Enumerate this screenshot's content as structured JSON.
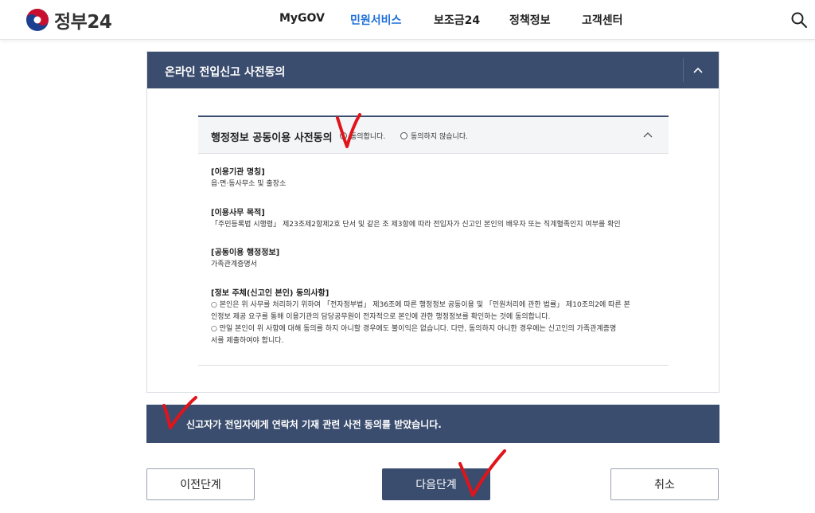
{
  "header": {
    "logo_text": "정부24",
    "nav": [
      {
        "label": "MyGOV"
      },
      {
        "label": "민원서비스"
      },
      {
        "label": "보조금24"
      },
      {
        "label": "정책정보"
      },
      {
        "label": "고객센터"
      }
    ],
    "search_icon": "search-icon",
    "active_color": "#1e6fd9"
  },
  "panel": {
    "title": "온라인 전입신고 사전동의",
    "toggle_icon": "chevron-up-icon",
    "header_color": "#3a4d6e",
    "sub": {
      "title": "행정정보 공동이용 사전동의",
      "agree_label": "동의합니다.",
      "disagree_label": "동의하지 않습니다.",
      "sections": [
        {
          "heading": "[이용기관 명칭]",
          "lines": [
            "읍·면·동사무소 및 출장소"
          ]
        },
        {
          "heading": "[이용사무 목적]",
          "lines": [
            "「주민등록법 시행령」 제23조제2항제2호 단서 및 같은 조 제3항에 따라 전입자가 신고인 본인의 배우자 또는 직계혈족인지 여부를 확인"
          ]
        },
        {
          "heading": "[공동이용 행정정보]",
          "lines": [
            "가족관계증명서"
          ]
        },
        {
          "heading": "[정보 주체(신고인 본인) 동의사항]",
          "lines": [
            "○ 본인은 위 사무를 처리하기 위하여 「전자정부법」 제36조에 따른 행정정보 공동이용 및 「민원처리에 관한 법률」 제10조의2에 따른 본",
            "인정보 제공 요구를 통해 이용기관의 담당공무원이 전자적으로 본인에 관한 행정정보를 확인하는 것에 동의합니다.",
            "○ 만일 본인이 위 사항에 대해 동의를 하지 아니할 경우에도 불이익은 없습니다. 다만, 동의하지 아니한 경우에는 신고인의 가족관계증명",
            "서를 제출하여야 합니다."
          ]
        }
      ]
    }
  },
  "consent_bar": {
    "text": "신고자가 전입자에게 연락처 기재 관련 사전 동의를 받았습니다."
  },
  "buttons": {
    "prev": "이전단계",
    "next": "다음단계",
    "cancel": "취소"
  },
  "annotation_color": "#e0141a"
}
